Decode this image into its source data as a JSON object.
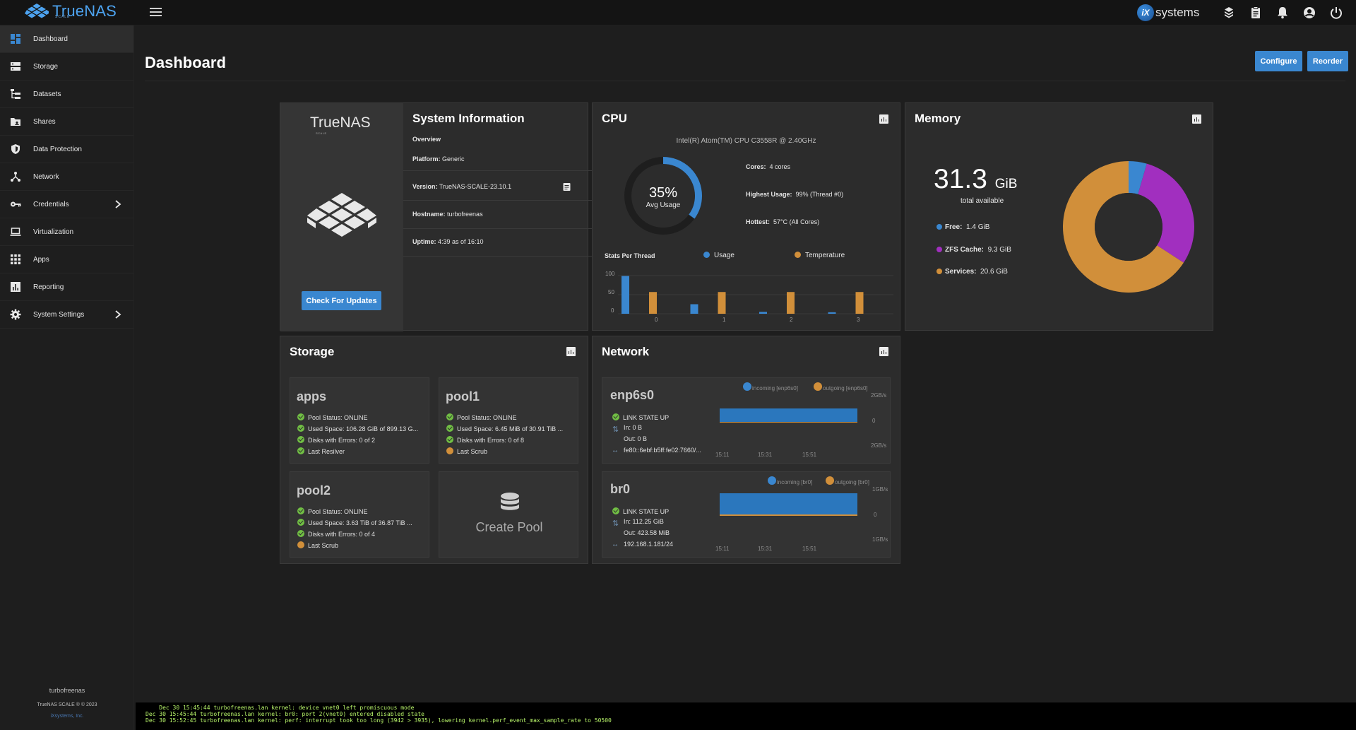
{
  "app": {
    "brand": "TrueNAS",
    "brand_sub": "SCALE",
    "vendor": "systems",
    "vendor_ix": "iX"
  },
  "header": {
    "title": "Dashboard",
    "configure_label": "Configure",
    "reorder_label": "Reorder"
  },
  "sidebar": {
    "items": [
      {
        "label": "Dashboard",
        "icon": "dashboard-icon"
      },
      {
        "label": "Storage",
        "icon": "storage-icon"
      },
      {
        "label": "Datasets",
        "icon": "datasets-icon"
      },
      {
        "label": "Shares",
        "icon": "shares-icon"
      },
      {
        "label": "Data Protection",
        "icon": "shield-icon"
      },
      {
        "label": "Network",
        "icon": "network-icon"
      },
      {
        "label": "Credentials",
        "icon": "key-icon"
      },
      {
        "label": "Virtualization",
        "icon": "laptop-icon"
      },
      {
        "label": "Apps",
        "icon": "apps-grid-icon"
      },
      {
        "label": "Reporting",
        "icon": "bar-chart-icon"
      },
      {
        "label": "System Settings",
        "icon": "gear-icon"
      }
    ],
    "hostname": "turbofreenas",
    "copyright": "TrueNAS SCALE ® © 2023",
    "company": "iXsystems, Inc."
  },
  "sysinfo": {
    "title": "System Information",
    "brand": "TrueNAS",
    "brand_sub": "SCALE",
    "overview": "Overview",
    "platform_label": "Platform:",
    "platform": "Generic",
    "version_label": "Version:",
    "version": "TrueNAS-SCALE-23.10.1",
    "hostname_label": "Hostname:",
    "hostname": "turbofreenas",
    "uptime_label": "Uptime:",
    "uptime": "4:39 as of 16:10",
    "update_button": "Check For Updates"
  },
  "cpu": {
    "title": "CPU",
    "model": "Intel(R) Atom(TM) CPU C3558R @ 2.40GHz",
    "usage_pct": "35%",
    "usage_fraction": 0.35,
    "usage_label": "Avg Usage",
    "cores_label": "Cores:",
    "cores": "4 cores",
    "highest_label": "Highest Usage:",
    "highest": "99%  (Thread #0)",
    "hottest_label": "Hottest:",
    "hottest": "57°C  (All Cores)",
    "threads_label": "Stats Per Thread",
    "legend_usage": "Usage",
    "legend_temp": "Temperature",
    "y_ticks": [
      "100",
      "50",
      "0"
    ],
    "chart_data": {
      "type": "bar",
      "categories": [
        "0",
        "1",
        "2",
        "3"
      ],
      "series": [
        {
          "name": "Usage",
          "values": [
            99,
            25,
            5,
            4
          ]
        },
        {
          "name": "Temperature",
          "values": [
            57,
            57,
            57,
            57
          ]
        }
      ],
      "ylim": [
        0,
        100
      ]
    },
    "colors": {
      "usage": "#3a87d0",
      "temperature": "#d18f3a"
    }
  },
  "memory": {
    "title": "Memory",
    "total": "31.3",
    "unit": "GiB",
    "total_label": "total available",
    "free_label": "Free:",
    "free": "1.4 GiB",
    "zfs_label": "ZFS Cache:",
    "zfs": "9.3 GiB",
    "services_label": "Services:",
    "services": "20.6 GiB",
    "chart_data": {
      "type": "pie",
      "categories": [
        "Free",
        "ZFS Cache",
        "Services"
      ],
      "values": [
        1.4,
        9.3,
        20.6
      ]
    },
    "colors": {
      "free": "#3a87d0",
      "zfs": "#a12fbf",
      "services": "#d18f3a"
    }
  },
  "storage": {
    "title": "Storage",
    "pools": [
      {
        "name": "apps",
        "status": "Pool Status:  ONLINE",
        "used": "Used Space:  106.28 GiB of 899.13 G...",
        "errors": "Disks with Errors:  0 of 2",
        "last": "Last Resilver"
      },
      {
        "name": "pool1",
        "status": "Pool Status:  ONLINE",
        "used": "Used Space:  6.45 MiB of 30.91 TiB ...",
        "errors": "Disks with Errors:  0 of 8",
        "last": "Last Scrub"
      },
      {
        "name": "pool2",
        "status": "Pool Status:  ONLINE",
        "used": "Used Space:  3.63 TiB of 36.87 TiB ...",
        "errors": "Disks with Errors:  0 of 4",
        "last": "Last Scrub"
      }
    ],
    "create_pool": "Create Pool"
  },
  "network": {
    "title": "Network",
    "nics": [
      {
        "name": "enp6s0",
        "state": "LINK STATE UP",
        "in": "In:   0 B",
        "out": "Out:  0 B",
        "addr": "fe80::6ebf:b5ff:fe02:7660/...",
        "legend_in": "incoming [enp6s0]",
        "legend_out": "outgoing [enp6s0]",
        "y_top": "2GB/s",
        "y_mid": "0",
        "y_bot": "2GB/s",
        "times": [
          "15:11",
          "15:31",
          "15:51"
        ]
      },
      {
        "name": "br0",
        "state": "LINK STATE UP",
        "in": "In:   112.25 GiB",
        "out": "Out:  423.58 MiB",
        "addr": "192.168.1.181/24",
        "legend_in": "incoming [br0]",
        "legend_out": "outgoing [br0]",
        "y_top": "1GB/s",
        "y_mid": "0",
        "y_bot": "1GB/s",
        "times": [
          "15:11",
          "15:31",
          "15:51"
        ]
      }
    ]
  },
  "console": {
    "lines": [
      "    Dec 30 15:45:44 turbofreenas.lan kernel: device vnet0 left promiscuous mode",
      "Dec 30 15:45:44 turbofreenas.lan kernel: br0: port 2(vnet0) entered disabled state",
      "Dec 30 15:52:45 turbofreenas.lan kernel: perf: interrupt took too long (3942 > 3935), lowering kernel.perf_event_max_sample_rate to 50500"
    ]
  }
}
